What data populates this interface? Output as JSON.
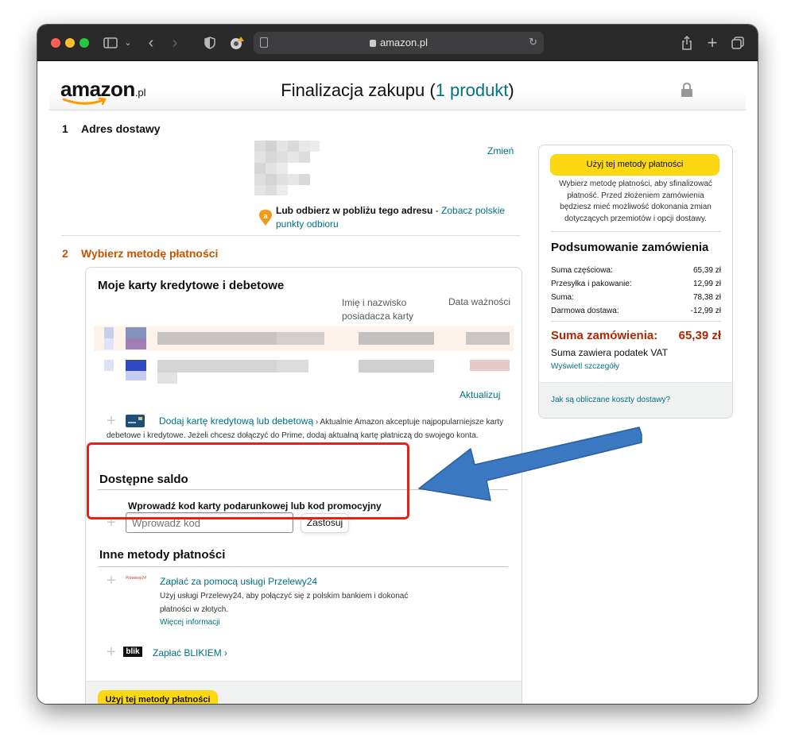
{
  "browser": {
    "url": "amazon.pl"
  },
  "header": {
    "logo_text": "amazon",
    "logo_suffix": ".pl",
    "title_prefix": "Finalizacja zakupu (",
    "title_link": "1 produkt",
    "title_suffix": ")"
  },
  "address": {
    "step_number": "1",
    "heading": "Adres dostawy",
    "change_link": "Zmień",
    "pickup_text": "Lub odbierz w pobliżu tego adresu",
    "pickup_dash": " - ",
    "pickup_link": "Zobacz polskie punkty odbioru"
  },
  "payment": {
    "step_number": "2",
    "heading": "Wybierz metodę płatności",
    "cards_heading": "Moje karty kredytowe i debetowe",
    "col_holder": "Imię i nazwisko posiadacza karty",
    "col_expiry": "Data ważności",
    "update_link": "Aktualizuj",
    "add_card_link": "Dodaj kartę kredytową lub debetową",
    "add_card_chevron": "›",
    "add_card_desc": "Aktualnie Amazon akceptuje najpopularniejsze karty debetowe i kredytowe. Jeżeli chcesz dołączyć do Prime, dodaj aktualną kartę płatniczą do swojego konta.",
    "balance_heading": "Dostępne saldo",
    "gift_label": "Wprowadź kod karty podarunkowej lub kod promocyjny",
    "gift_placeholder": "Wprowadź kod",
    "apply_button": "Zastosuj",
    "other_heading": "Inne metody płatności",
    "p24_logo": "Przelewy24",
    "p24_link": "Zapłać za pomocą usługi Przelewy24",
    "p24_desc": "Użyj usługi Przelewy24, aby połączyć się z polskim bankiem i dokonać płatności w złotych.",
    "p24_more": "Więcej informacji",
    "blik_logo": "blik",
    "blik_link": "Zapłać BLIKIEM",
    "blik_chevron": "›",
    "use_method_button": "Użyj tej metody płatności"
  },
  "summary": {
    "use_method_button": "Użyj tej metody płatności",
    "info_text": "Wybierz metodę płatności, aby sfinalizować płatność. Przed złożeniem zamówienia będziesz mieć możliwość dokonania zmian dotyczących przemiotów i opcji dostawy.",
    "heading": "Podsumowanie zamówienia",
    "rows": [
      {
        "label": "Suma częściowa:",
        "value": "65,39 zł"
      },
      {
        "label": "Przesyłka i pakowanie:",
        "value": "12,99 zł"
      },
      {
        "label": "Suma:",
        "value": "78,38 zł"
      },
      {
        "label": "Darmowa dostawa:",
        "value": "-12,99 zł"
      }
    ],
    "total_label": "Suma zamówienia:",
    "total_value": "65,39 zł",
    "vat_text": "Suma zawiera podatek VAT",
    "details_link": "Wyświetl szczegóły",
    "shipping_link": "Jak są obliczane koszty dostawy?"
  },
  "colors": {
    "link": "#007185",
    "accent_orange": "#c45500",
    "price_red": "#b12704",
    "button_yellow": "#ffd814",
    "annotation_red": "#e2231a",
    "annotation_arrow": "#3a78c2"
  }
}
